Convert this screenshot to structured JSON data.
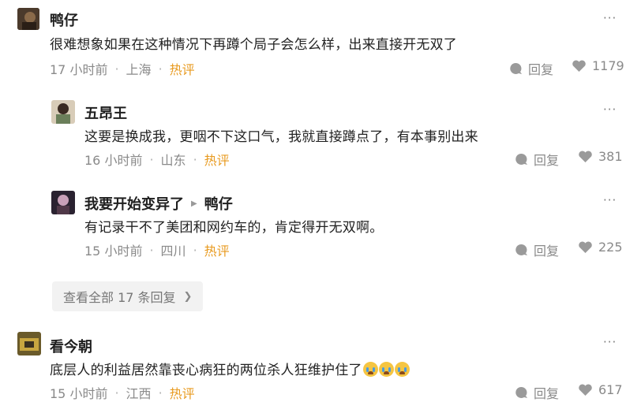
{
  "comments": [
    {
      "name": "鸭仔",
      "text": "很难想象如果在这种情况下再蹲个局子会怎么样，出来直接开无双了",
      "time": "17 小时前",
      "location": "上海",
      "badge": "热评",
      "reply_label": "回复",
      "likes": "1179",
      "more_icon": "···"
    },
    {
      "name": "五昂王",
      "text": "这要是换成我，更咽不下这口气，我就直接蹲点了，有本事别出来",
      "time": "16 小时前",
      "location": "山东",
      "badge": "热评",
      "reply_label": "回复",
      "likes": "381",
      "more_icon": "···"
    },
    {
      "name": "我要开始变异了",
      "reply_to": "鸭仔",
      "text": "有记录干不了美团和网约车的，肯定得开无双啊。",
      "time": "15 小时前",
      "location": "四川",
      "badge": "热评",
      "reply_label": "回复",
      "likes": "225",
      "more_icon": "···"
    },
    {
      "name": "看今朝",
      "text": "底层人的利益居然靠丧心病狂的两位杀人狂维护住了",
      "time": "15 小时前",
      "location": "江西",
      "badge": "热评",
      "reply_label": "回复",
      "likes": "617",
      "more_icon": "···"
    }
  ],
  "view_all_replies": "查看全部 17 条回复",
  "view_all_chevron": "❯",
  "separator": "·",
  "reply_arrow": "▶",
  "colors": {
    "hot": "#e89a1f",
    "meta": "#8a8a8a",
    "button_bg": "#f2f2f2"
  },
  "icons": {
    "reply": "speech-bubble-icon",
    "like": "heart-icon",
    "more": "more-dots-icon",
    "emoji": "crying-face-emoji"
  }
}
